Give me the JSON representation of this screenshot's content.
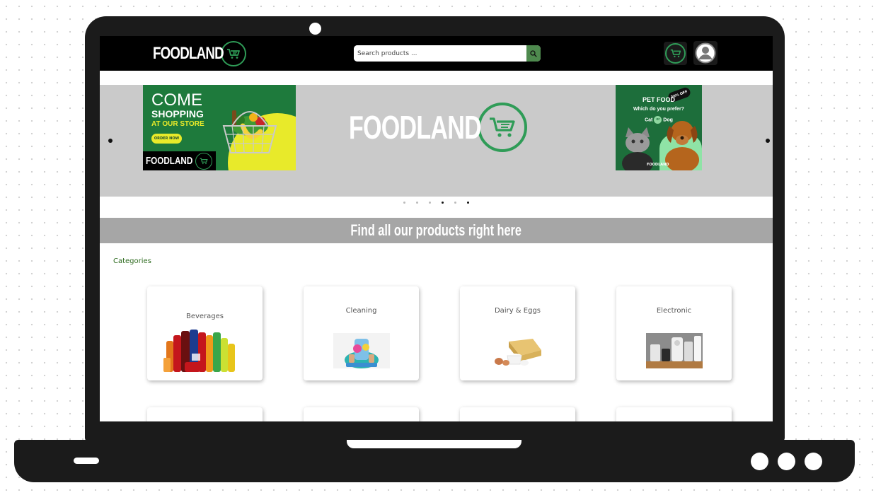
{
  "brand": {
    "name": "FOODLAND",
    "accent_color": "#2f9c57"
  },
  "header": {
    "search_placeholder": "Search products ...",
    "search_icon": "search-icon",
    "cart_icon": "cart-icon",
    "user_icon": "user-icon"
  },
  "carousel": {
    "left_banner": {
      "line1": "COME",
      "line2": "SHOPPING",
      "line3": "AT OUR STORE",
      "button": "ORDER NOW",
      "brand": "FOODLAND"
    },
    "center_brand": "FOODLAND",
    "right_banner": {
      "badge": "30% OFF",
      "title": "PET FOOD",
      "subtitle": "Which do you prefer?",
      "cat": "Cat",
      "or": "or",
      "dog": "Dog",
      "brand": "FOODLAND"
    },
    "indicators": 6,
    "active_indicator": 4
  },
  "products_banner": "Find all our products right here",
  "categories": {
    "label": "Categories",
    "items": [
      {
        "name": "Beverages"
      },
      {
        "name": "Cleaning"
      },
      {
        "name": "Dairy & Eggs"
      },
      {
        "name": "Electronic"
      }
    ]
  }
}
